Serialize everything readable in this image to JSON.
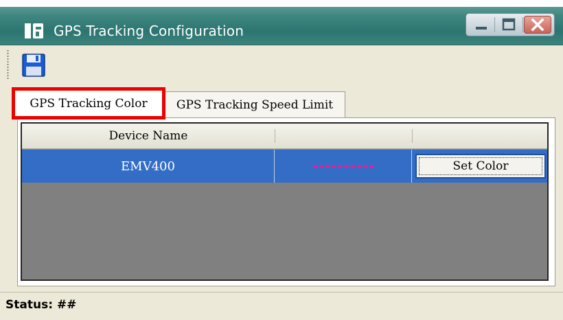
{
  "window": {
    "title": "GPS Tracking Configuration",
    "title_color": "#ffffff",
    "titlebar_color": "#3a807a",
    "controls": [
      "minimize-icon",
      "maximize-icon",
      "close-icon"
    ]
  },
  "toolbar": {
    "save_icon": "floppy-disk-icon"
  },
  "tabs": [
    {
      "label": "GPS Tracking Color",
      "selected": true,
      "highlight_color": "#ee0000"
    },
    {
      "label": "GPS Tracking Speed Limit",
      "selected": false
    }
  ],
  "grid": {
    "columns": [
      "Device Name",
      "",
      ""
    ],
    "rows": [
      {
        "device_name": "EMV400",
        "line_style": "dashed",
        "color": "#ff1493",
        "action_label": "Set Color",
        "selected": true
      }
    ],
    "selection_color": "#336dc6",
    "empty_area_color": "#808080"
  },
  "status": {
    "label": "Status:",
    "value": "##"
  }
}
